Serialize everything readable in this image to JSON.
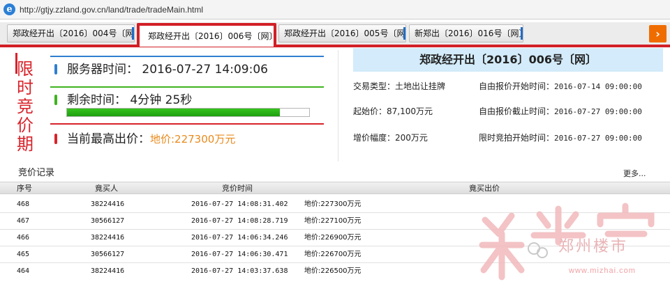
{
  "browser": {
    "url": "http://gtjy.zzland.gov.cn/land/trade/tradeMain.html"
  },
  "tabs": [
    {
      "label": "郑政经开出〔2016〕004号〔网〕",
      "active": false
    },
    {
      "label": "郑政经开出〔2016〕006号〔网〕",
      "active": true
    },
    {
      "label": "郑政经开出〔2016〕005号〔网〕",
      "active": false
    },
    {
      "label": "新郑出〔2016〕016号〔网〕",
      "active": false
    }
  ],
  "tab_next_icon": "chevron-right-icon",
  "status": {
    "period_label": "限时竞价期",
    "server_time_label": "服务器时间：",
    "server_time": "2016-07-27 14:09:06",
    "remaining_label": "剩余时间：",
    "remaining": "4分钟 25秒",
    "progress_fraction": 0.88,
    "highest_label": "当前最高出价：",
    "highest_value": "地价:227300万元",
    "colors": {
      "blue": "#2f7fd0",
      "green": "#3fb31f",
      "red": "#d8232a",
      "orange": "#e98a1c"
    }
  },
  "detail": {
    "title": "郑政经开出〔2016〕006号〔网〕",
    "trade_type_label": "交易类型：",
    "trade_type": "土地出让挂牌",
    "start_price_label": "起始价：",
    "start_price": "87,100万元",
    "increment_label": "增价幅度：",
    "increment": "200万元",
    "auto_start_label": "自由报价开始时间：",
    "auto_start": "2016-07-14 09:00:00",
    "auto_end_label": "自由报价截止时间：",
    "auto_end": "2016-07-27 09:00:00",
    "limit_start_label": "限时竞拍开始时间：",
    "limit_start": "2016-07-27 09:00:00"
  },
  "records": {
    "title": "竞价记录",
    "more": "更多...",
    "headers": [
      "序号",
      "竟买人",
      "竞价时间",
      "竟买出价"
    ],
    "rows": [
      [
        "468",
        "38224416",
        "2016-07-27 14:08:31.402",
        "地价:227300万元"
      ],
      [
        "467",
        "30566127",
        "2016-07-27 14:08:28.719",
        "地价:227100万元"
      ],
      [
        "466",
        "38224416",
        "2016-07-27 14:06:34.246",
        "地价:226900万元"
      ],
      [
        "465",
        "30566127",
        "2016-07-27 14:06:30.471",
        "地价:226700万元"
      ],
      [
        "464",
        "38224416",
        "2016-07-27 14:03:37.638",
        "地价:226500万元"
      ]
    ]
  },
  "watermark": {
    "brand": "米宅",
    "name": "郑州楼市",
    "site": "www.mizhai.com"
  }
}
